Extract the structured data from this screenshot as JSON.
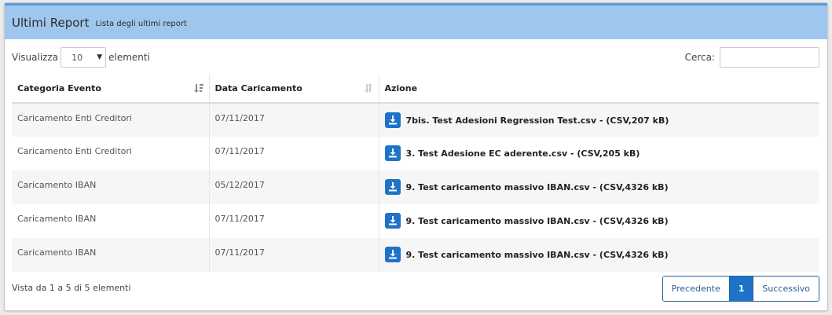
{
  "header": {
    "title": "Ultimi Report",
    "subtitle": "Lista degli ultimi report"
  },
  "length": {
    "label_before": "Visualizza",
    "value": "10",
    "label_after": "elementi"
  },
  "search": {
    "label": "Cerca:",
    "value": ""
  },
  "table": {
    "columns": [
      "Categoria Evento",
      "Data Caricamento",
      "Azione"
    ],
    "rows": [
      {
        "categoria": "Caricamento Enti Creditori",
        "data": "07/11/2017",
        "azione": "7bis. Test Adesioni Regression Test.csv - (CSV,207 kB)"
      },
      {
        "categoria": "Caricamento Enti Creditori",
        "data": "07/11/2017",
        "azione": "3. Test Adesione EC aderente.csv - (CSV,205 kB)"
      },
      {
        "categoria": "Caricamento IBAN",
        "data": "05/12/2017",
        "azione": "9. Test caricamento massivo IBAN.csv - (CSV,4326 kB)"
      },
      {
        "categoria": "Caricamento IBAN",
        "data": "07/11/2017",
        "azione": "9. Test caricamento massivo IBAN.csv - (CSV,4326 kB)"
      },
      {
        "categoria": "Caricamento IBAN",
        "data": "07/11/2017",
        "azione": "9. Test caricamento massivo IBAN.csv - (CSV,4326 kB)"
      }
    ]
  },
  "footer": {
    "info": "Vista da 1 a 5 di 5 elementi"
  },
  "pagination": {
    "prev": "Precedente",
    "current": "1",
    "next": "Successivo"
  },
  "colors": {
    "header_bg": "#9fc7ee",
    "accent": "#1e73c8"
  }
}
